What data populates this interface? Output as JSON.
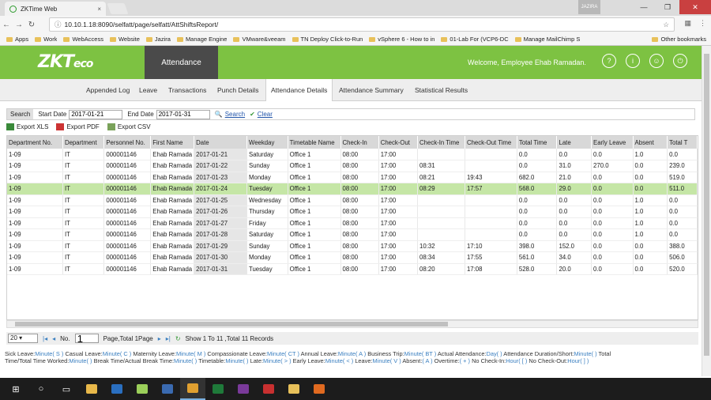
{
  "browser": {
    "tab_title": "ZKTime Web",
    "tab_close": "×",
    "url": "10.10.1.18:8090/selfatt/page/selfatt/AttShiftsReport/",
    "star": "☆",
    "user_badge": "JAZIRA",
    "win_min": "—",
    "win_max": "❐",
    "win_close": "✕",
    "bookmarks": [
      "Apps",
      "Work",
      "WebAccess",
      "Website",
      "Jazira",
      "Manage Engine",
      "VMware&veeam",
      "TN Deploy Click-to-Run",
      "vSphere 6 - How to in",
      "01-Lab For (VCP6-DC",
      "Manage MailChimp S"
    ],
    "bookmarks_other": "Other bookmarks"
  },
  "app": {
    "logo_main": "ZKT",
    "logo_tail": "eco",
    "module": "Attendance",
    "welcome": "Welcome, Employee Ehab Ramadan.",
    "header_icons": [
      "help-icon",
      "info-icon",
      "user-icon",
      "power-icon"
    ],
    "subnav": [
      "Appended Log",
      "Leave",
      "Transactions",
      "Punch Details",
      "Attendance Details",
      "Attendance Summary",
      "Statistical Results"
    ],
    "active_tab": "Attendance Details"
  },
  "search": {
    "label": "Search",
    "start_label": "Start Date",
    "start_value": "2017-01-21",
    "end_label": "End Date",
    "end_value": "2017-01-31",
    "search_link": "Search",
    "clear_link": "Clear"
  },
  "exports": {
    "xls": "Export XLS",
    "pdf": "Export PDF",
    "csv": "Export CSV"
  },
  "table": {
    "columns": [
      "Department No.",
      "Department",
      "Personnel No.",
      "First Name",
      "Date",
      "Weekday",
      "Timetable Name",
      "Check-In",
      "Check-Out",
      "Check-In Time",
      "Check-Out Time",
      "Total Time",
      "Late",
      "Early Leave",
      "Absent",
      "Total T"
    ],
    "rows": [
      [
        "1-09",
        "IT",
        "000001146",
        "Ehab Ramada",
        "2017-01-21",
        "Saturday",
        "Office 1",
        "08:00",
        "17:00",
        "",
        "",
        "0.0",
        "0.0",
        "0.0",
        "1.0",
        "0.0"
      ],
      [
        "1-09",
        "IT",
        "000001146",
        "Ehab Ramada",
        "2017-01-22",
        "Sunday",
        "Office 1",
        "08:00",
        "17:00",
        "08:31",
        "",
        "0.0",
        "31.0",
        "270.0",
        "0.0",
        "239.0"
      ],
      [
        "1-09",
        "IT",
        "000001146",
        "Ehab Ramada",
        "2017-01-23",
        "Monday",
        "Office 1",
        "08:00",
        "17:00",
        "08:21",
        "19:43",
        "682.0",
        "21.0",
        "0.0",
        "0.0",
        "519.0"
      ],
      [
        "1-09",
        "IT",
        "000001146",
        "Ehab Ramada",
        "2017-01-24",
        "Tuesday",
        "Office 1",
        "08:00",
        "17:00",
        "08:29",
        "17:57",
        "568.0",
        "29.0",
        "0.0",
        "0.0",
        "511.0"
      ],
      [
        "1-09",
        "IT",
        "000001146",
        "Ehab Ramada",
        "2017-01-25",
        "Wednesday",
        "Office 1",
        "08:00",
        "17:00",
        "",
        "",
        "0.0",
        "0.0",
        "0.0",
        "1.0",
        "0.0"
      ],
      [
        "1-09",
        "IT",
        "000001146",
        "Ehab Ramada",
        "2017-01-26",
        "Thursday",
        "Office 1",
        "08:00",
        "17:00",
        "",
        "",
        "0.0",
        "0.0",
        "0.0",
        "1.0",
        "0.0"
      ],
      [
        "1-09",
        "IT",
        "000001146",
        "Ehab Ramada",
        "2017-01-27",
        "Friday",
        "Office 1",
        "08:00",
        "17:00",
        "",
        "",
        "0.0",
        "0.0",
        "0.0",
        "1.0",
        "0.0"
      ],
      [
        "1-09",
        "IT",
        "000001146",
        "Ehab Ramada",
        "2017-01-28",
        "Saturday",
        "Office 1",
        "08:00",
        "17:00",
        "",
        "",
        "0.0",
        "0.0",
        "0.0",
        "1.0",
        "0.0"
      ],
      [
        "1-09",
        "IT",
        "000001146",
        "Ehab Ramada",
        "2017-01-29",
        "Sunday",
        "Office 1",
        "08:00",
        "17:00",
        "10:32",
        "17:10",
        "398.0",
        "152.0",
        "0.0",
        "0.0",
        "388.0"
      ],
      [
        "1-09",
        "IT",
        "000001146",
        "Ehab Ramada",
        "2017-01-30",
        "Monday",
        "Office 1",
        "08:00",
        "17:00",
        "08:34",
        "17:55",
        "561.0",
        "34.0",
        "0.0",
        "0.0",
        "506.0"
      ],
      [
        "1-09",
        "IT",
        "000001146",
        "Ehab Ramada",
        "2017-01-31",
        "Tuesday",
        "Office 1",
        "08:00",
        "17:00",
        "08:20",
        "17:08",
        "528.0",
        "20.0",
        "0.0",
        "0.0",
        "520.0"
      ]
    ],
    "highlighted_row": 3
  },
  "pager": {
    "page_size": "20",
    "no_label": "No.",
    "page_value": "1",
    "page_total": "Page,Total 1Page",
    "summary": "Show 1 To 11 ,Total 11 Records"
  },
  "legend": {
    "line1": [
      [
        "Sick Leave:",
        "Minute( S )"
      ],
      [
        "Casual Leave:",
        "Minute( C )"
      ],
      [
        "Maternity Leave:",
        "Minute( M )"
      ],
      [
        "Compassionate Leave:",
        "Minute( CT )"
      ],
      [
        "Annual Leave:",
        "Minute( A )"
      ],
      [
        "Business Trip:",
        "Minute( BT )"
      ],
      [
        "Actual Attendance:",
        "Day( )"
      ],
      [
        "Attendance Duration/Short:",
        "Minute( )"
      ],
      [
        "Total",
        ""
      ]
    ],
    "line2": [
      [
        "Time/Total Time Worked:",
        "Minute( )"
      ],
      [
        "Break Time/Actual Break Time:",
        "Minute( )"
      ],
      [
        "Timetable:",
        "Minute( )"
      ],
      [
        "Late:",
        "Minute( > )"
      ],
      [
        "Early Leave:",
        "Minute( < )"
      ],
      [
        "Leave:",
        "Minute( V )"
      ],
      [
        "Absent:",
        "( A )"
      ],
      [
        "Overtime:",
        "( + )"
      ],
      [
        "No Check-In:",
        "Hour( [ )"
      ],
      [
        "No Check-Out:",
        "Hour( ] )"
      ]
    ]
  },
  "taskbar": [
    "windows-start-icon",
    "search-icon",
    "task-view-icon",
    "file-explorer-icon",
    "outlook-icon",
    "app-icon",
    "rdp-icon",
    "chrome-icon",
    "excel-icon",
    "onenote-icon",
    "acrobat-icon",
    "folder-icon",
    "app-orange-icon"
  ]
}
